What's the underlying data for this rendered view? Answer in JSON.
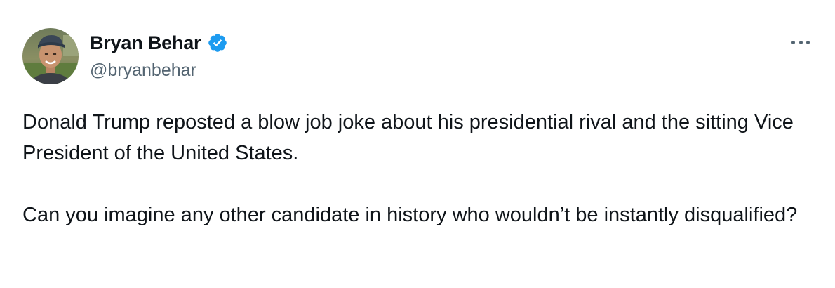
{
  "author": {
    "display_name": "Bryan Behar",
    "handle": "@bryanbehar",
    "verified": true,
    "verified_icon": "verified-badge-icon",
    "verified_color": "#1d9bf0"
  },
  "menu": {
    "icon": "more-horizontal-icon"
  },
  "tweet": {
    "paragraphs": [
      "Donald Trump reposted a blow job joke about his presidential rival and the sitting Vice President of the United States.",
      "Can you imagine any other candidate in history who wouldn’t be instantly disqualified?"
    ]
  },
  "colors": {
    "text": "#0f1419",
    "secondary": "#536471",
    "background": "#ffffff"
  }
}
